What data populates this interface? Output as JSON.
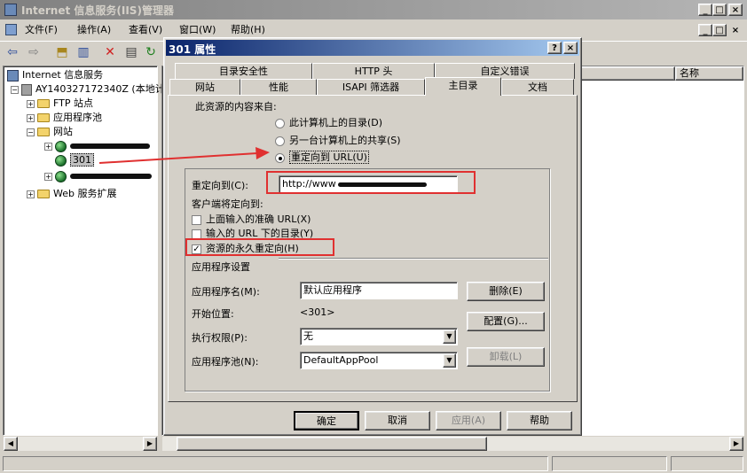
{
  "main_window": {
    "title": "Internet 信息服务(IIS)管理器",
    "controls": [
      "_",
      "□",
      "×"
    ]
  },
  "menu": {
    "items": [
      "文件(F)",
      "操作(A)",
      "查看(V)",
      "窗口(W)",
      "帮助(H)"
    ],
    "child_controls": [
      "_",
      "□",
      "×"
    ]
  },
  "tree": {
    "root": "Internet 信息服务",
    "server": "AY140327172340Z (本地计",
    "ftp": "FTP 站点",
    "app_pools": "应用程序池",
    "sites": "网站",
    "site_301": "301",
    "web_ext": "Web 服务扩展"
  },
  "right_panel": {
    "column_name": "名称"
  },
  "dialog": {
    "title": "301 属性",
    "help_btn": "?",
    "close_btn": "×",
    "tabs_row1": [
      "目录安全性",
      "HTTP 头",
      "自定义错误"
    ],
    "tabs_row2": [
      "网站",
      "性能",
      "ISAPI 筛选器",
      "主目录",
      "文档"
    ],
    "content_source_label": "此资源的内容来自:",
    "radio_local": "此计算机上的目录(D)",
    "radio_share": "另一台计算机上的共享(S)",
    "radio_url": "重定向到 URL(U)",
    "redirect_label": "重定向到(C):",
    "redirect_value": "http://www",
    "client_redirect_label": "客户端将定向到:",
    "check_exact": "上面输入的准确 URL(X)",
    "check_dir": "输入的 URL 下的目录(Y)",
    "check_permanent": "资源的永久重定向(H)",
    "app_settings_label": "应用程序设置",
    "app_name_label": "应用程序名(M):",
    "app_name_value": "默认应用程序",
    "start_label": "开始位置:",
    "start_value": "<301>",
    "exec_label": "执行权限(P):",
    "exec_value": "无",
    "pool_label": "应用程序池(N):",
    "pool_value": "DefaultAppPool",
    "remove_btn": "删除(E)",
    "config_btn": "配置(G)...",
    "unload_btn": "卸载(L)",
    "ok_btn": "确定",
    "cancel_btn": "取消",
    "apply_btn": "应用(A)",
    "help_bottom_btn": "帮助"
  },
  "colors": {
    "title_active": "#0a246a",
    "title_inactive": "#808080",
    "highlight_red": "#e03030"
  }
}
